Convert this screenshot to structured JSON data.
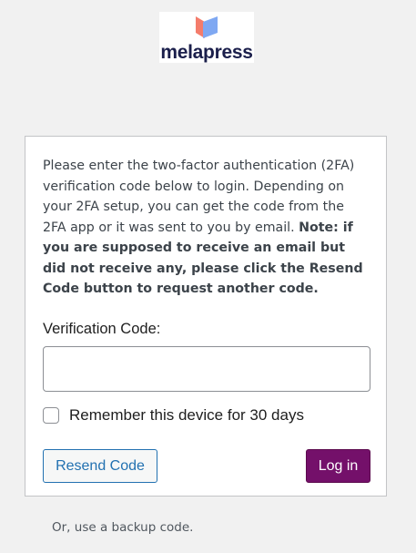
{
  "brand": {
    "name": "melapress"
  },
  "form": {
    "message_plain": "Please enter the two-factor authentication (2FA) verification code below to login. Depending on your 2FA setup, you can get the code from the 2FA app or it was sent to you by email.",
    "message_bold": "Note: if you are supposed to receive an email but did not receive any, please click the Resend Code button to request another code.",
    "code_label": "Verification Code:",
    "code_value": "",
    "remember_label": "Remember this device for 30 days",
    "remember_checked": false,
    "resend_label": "Resend Code",
    "login_label": "Log in"
  },
  "footer": {
    "backup_link": "Or, use a backup code."
  },
  "colors": {
    "primary": "#74106a",
    "link": "#2271b1",
    "logo_coral": "#f47c6b",
    "logo_blue": "#7fa8f2"
  }
}
